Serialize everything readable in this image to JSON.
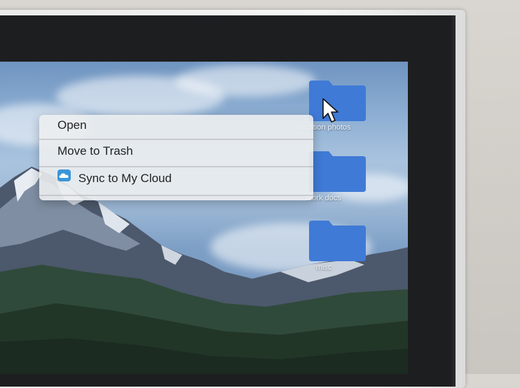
{
  "context_menu": {
    "items": [
      {
        "label": "Open",
        "icon": null
      },
      {
        "label": "Move to Trash",
        "icon": null
      },
      {
        "label": "Sync to My Cloud",
        "icon": "cloud-sync-icon"
      }
    ]
  },
  "desktop": {
    "folders": [
      {
        "label": "vacation photos"
      },
      {
        "label": "work docs"
      },
      {
        "label": "misc"
      }
    ]
  },
  "colors": {
    "folder_blue": "#3f7ad6",
    "cloud_icon": "#3a96d8",
    "bezel": "#1d1e20"
  }
}
